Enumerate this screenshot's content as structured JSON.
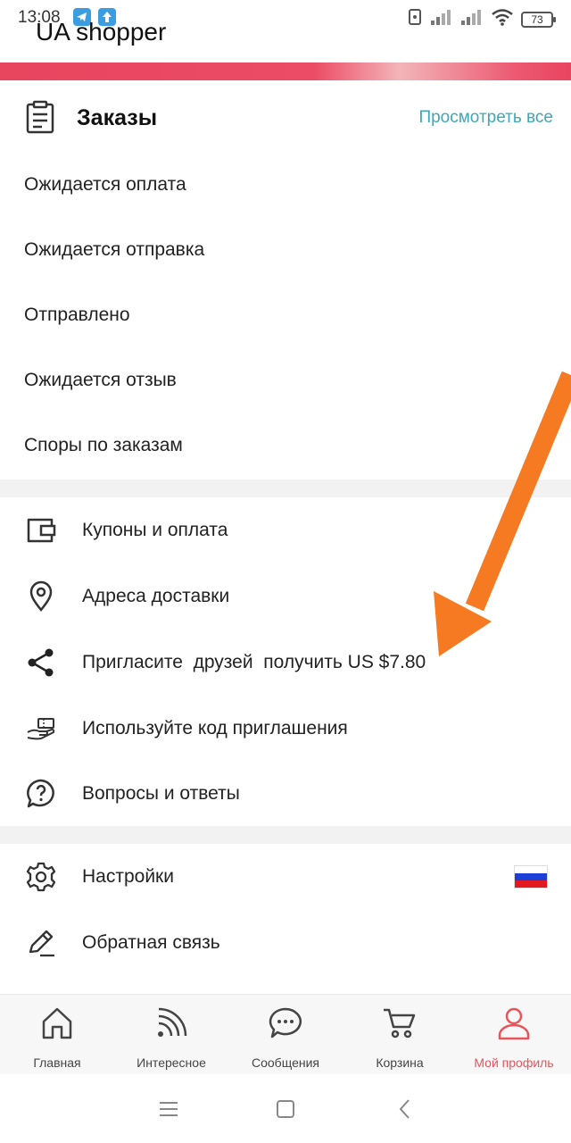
{
  "status_bar": {
    "time": "13:08",
    "battery": "73"
  },
  "overlay_title": "UA shopper",
  "orders": {
    "title": "Заказы",
    "view_all": "Просмотреть все",
    "items": [
      "Ожидается оплата",
      "Ожидается отправка",
      "Отправлено",
      "Ожидается отзыв",
      "Споры по заказам"
    ]
  },
  "menu": {
    "coupons": "Купоны и оплата",
    "addresses": "Адреса доставки",
    "invite": "Пригласите  друзей  получить US $7.80",
    "invite_code": "Используйте код приглашения",
    "faq": "Вопросы и ответы",
    "settings": "Настройки",
    "feedback": "Обратная связь"
  },
  "bottom_nav": {
    "items": [
      {
        "label": "Главная",
        "icon": "home-icon"
      },
      {
        "label": "Интересное",
        "icon": "feed-icon"
      },
      {
        "label": "Сообщения",
        "icon": "chat-icon"
      },
      {
        "label": "Корзина",
        "icon": "cart-icon"
      },
      {
        "label": "Мой профиль",
        "icon": "profile-icon"
      }
    ],
    "active_index": 4
  },
  "colors": {
    "accent": "#e8545c",
    "link": "#3fa7b7",
    "arrow": "#f57a22",
    "banner": "#e8455f"
  }
}
